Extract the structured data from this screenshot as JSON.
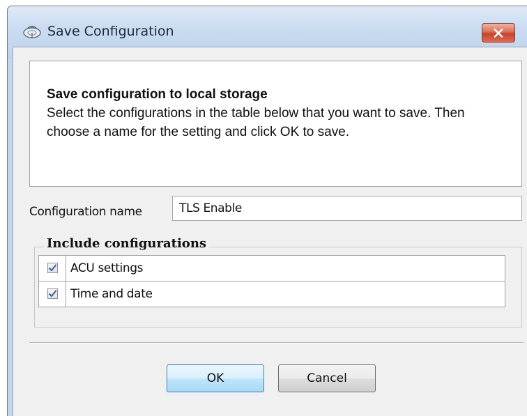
{
  "window": {
    "title": "Save Configuration",
    "icon": "satellite-dish-icon",
    "close_icon": "close-icon"
  },
  "info": {
    "title": "Save configuration to local storage",
    "body": "Select the configurations in the table below that you want to save. Then choose a name for the setting and click OK to save."
  },
  "config_name": {
    "label": "Configuration name",
    "value": "TLS Enable"
  },
  "include": {
    "title": "Include configurations",
    "rows": [
      {
        "label": "ACU settings",
        "checked": true
      },
      {
        "label": "Time and date",
        "checked": true
      }
    ]
  },
  "buttons": {
    "ok": "OK",
    "cancel": "Cancel"
  },
  "colors": {
    "titlebar": "#c9dbf0",
    "close_button": "#c8432c",
    "ok_border": "#3c7fb1",
    "dialog_bg": "#f0f0f0"
  }
}
